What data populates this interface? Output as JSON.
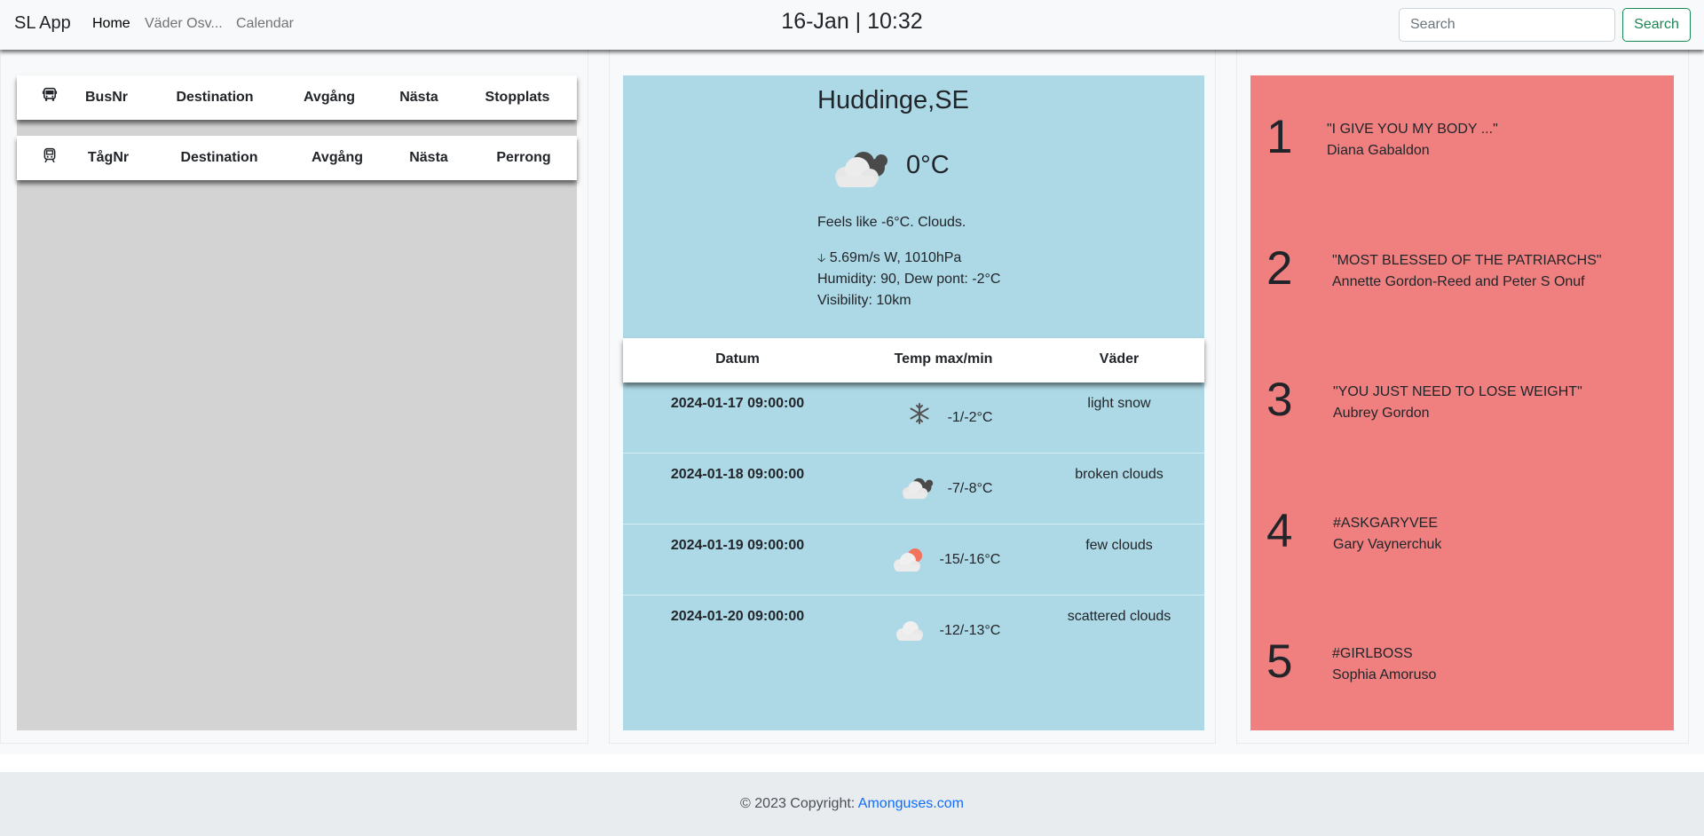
{
  "navbar": {
    "brand": "SL App",
    "links": [
      "Home",
      "Väder Osv...",
      "Calendar"
    ],
    "clock": "16-Jan | 10:32",
    "search_placeholder": "Search",
    "search_button": "Search"
  },
  "bus_table": {
    "headers": [
      "BusNr",
      "Destination",
      "Avgång",
      "Nästa",
      "Stopplats"
    ]
  },
  "train_table": {
    "headers": [
      "TågNr",
      "Destination",
      "Avgång",
      "Nästa",
      "Perrong"
    ]
  },
  "weather": {
    "city": "Huddinge,SE",
    "temperature": "0°C",
    "icon": "broken-clouds-icon",
    "feels_like": "Feels like -6°C. Clouds.",
    "wind": "5.69m/s W, 1010hPa",
    "humidity": "Humidity: 90, Dew pont: -2°C",
    "visibility": "Visibility: 10km"
  },
  "forecast": {
    "headers": [
      "Datum",
      "Temp max/min",
      "Väder"
    ],
    "rows": [
      {
        "date": "2024-01-17 09:00:00",
        "temp": "-1/-2°C",
        "description": "light snow",
        "icon": "snowflake-icon"
      },
      {
        "date": "2024-01-18 09:00:00",
        "temp": "-7/-8°C",
        "description": "broken clouds",
        "icon": "broken-clouds-icon"
      },
      {
        "date": "2024-01-19 09:00:00",
        "temp": "-15/-16°C",
        "description": "few clouds",
        "icon": "few-clouds-icon"
      },
      {
        "date": "2024-01-20 09:00:00",
        "temp": "-12/-13°C",
        "description": "scattered clouds",
        "icon": "scattered-clouds-icon"
      }
    ]
  },
  "books": [
    {
      "rank": "1",
      "title": "\"I GIVE YOU MY BODY ...\"",
      "author": "Diana Gabaldon"
    },
    {
      "rank": "2",
      "title": "\"MOST BLESSED OF THE PATRIARCHS\"",
      "author": "Annette Gordon-Reed and Peter S Onuf"
    },
    {
      "rank": "3",
      "title": "\"YOU JUST NEED TO LOSE WEIGHT\"",
      "author": "Aubrey Gordon"
    },
    {
      "rank": "4",
      "title": "#ASKGARYVEE",
      "author": "Gary Vaynerchuk"
    },
    {
      "rank": "5",
      "title": "#GIRLBOSS",
      "author": "Sophia Amoruso"
    }
  ],
  "footer": {
    "text": "© 2023 Copyright: ",
    "link": "Amonguses.com"
  },
  "colors": {
    "weather_bg": "#add8e6",
    "books_bg": "#f08080",
    "left_panel_bg": "#d3d3d3",
    "search_accent": "#198754",
    "link": "#0d6efd"
  }
}
